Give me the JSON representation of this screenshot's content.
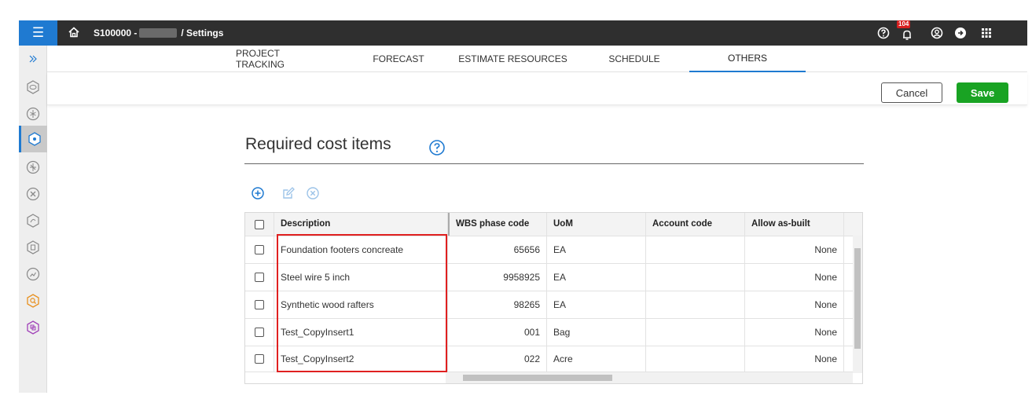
{
  "topbar": {
    "project_code": "S100000 -",
    "separator_page": "/ Settings",
    "notification_count": "104",
    "icons": [
      "menu-icon",
      "home-icon",
      "help-icon",
      "bell-icon",
      "user-icon",
      "logout-icon",
      "apps-grid-icon"
    ]
  },
  "rail": {
    "items": [
      "expand-icon",
      "estimate-icon",
      "project-tracking-icon",
      "cost-items-icon",
      "schedule-icon",
      "resources-icon",
      "forecast-icon",
      "documents-icon",
      "reports-icon",
      "search-icon",
      "integration-icon"
    ]
  },
  "tabs": [
    {
      "label": "PROJECT TRACKING"
    },
    {
      "label": "FORECAST"
    },
    {
      "label": "ESTIMATE RESOURCES"
    },
    {
      "label": "SCHEDULE"
    },
    {
      "label": "OTHERS"
    }
  ],
  "active_tab": "OTHERS",
  "actions": {
    "cancel": "Cancel",
    "save": "Save"
  },
  "colors": {
    "accent": "#1f7ad1",
    "save": "#19a323",
    "highlight": "#e02020",
    "topbar": "#2f2f2f"
  },
  "section": {
    "title": "Required cost items"
  },
  "toolbar": [
    "add-icon",
    "edit-icon",
    "delete-icon"
  ],
  "table": {
    "columns": [
      "Description",
      "WBS phase code",
      "UoM",
      "Account code",
      "Allow as-built"
    ],
    "rows": [
      {
        "description": "Foundation footers concreate",
        "wbs": "65656",
        "uom": "EA",
        "account": "",
        "allow": "None"
      },
      {
        "description": "Steel wire 5 inch",
        "wbs": "9958925",
        "uom": "EA",
        "account": "",
        "allow": "None"
      },
      {
        "description": "Synthetic wood rafters",
        "wbs": "98265",
        "uom": "EA",
        "account": "",
        "allow": "None"
      },
      {
        "description": "Test_CopyInsert1",
        "wbs": "001",
        "uom": "Bag",
        "account": "",
        "allow": "None"
      },
      {
        "description": "Test_CopyInsert2",
        "wbs": "022",
        "uom": "Acre",
        "account": "",
        "allow": "None"
      }
    ]
  }
}
